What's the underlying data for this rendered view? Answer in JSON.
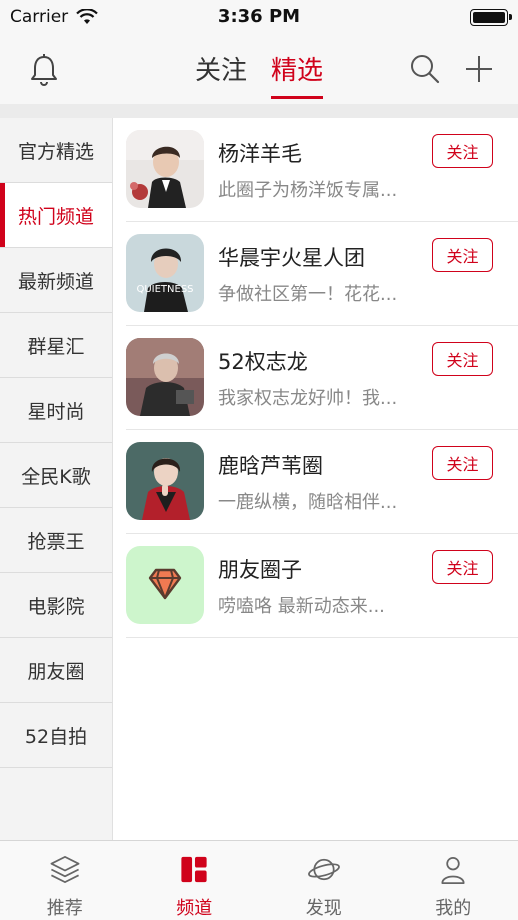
{
  "status_bar": {
    "carrier": "Carrier",
    "time": "3:36 PM"
  },
  "nav": {
    "tabs": [
      {
        "label": "关注"
      },
      {
        "label": "精选"
      }
    ],
    "active_tab": 1,
    "icons": {
      "left": "bell-icon",
      "search": "search-icon",
      "add": "plus-icon"
    }
  },
  "sidebar": {
    "items": [
      {
        "label": "官方精选"
      },
      {
        "label": "热门频道"
      },
      {
        "label": "最新频道"
      },
      {
        "label": "群星汇"
      },
      {
        "label": "星时尚"
      },
      {
        "label": "全民K歌"
      },
      {
        "label": "抢票王"
      },
      {
        "label": "电影院"
      },
      {
        "label": "朋友圈"
      },
      {
        "label": "52自拍"
      }
    ],
    "active_index": 1
  },
  "list": {
    "follow_label": "关注",
    "items": [
      {
        "title": "杨洋羊毛",
        "desc": "此圈子为杨洋饭专属..."
      },
      {
        "title": "华晨宇火星人团",
        "desc": "争做社区第一！花花...",
        "avatar_text": "QUIETNESS"
      },
      {
        "title": "52权志龙",
        "desc": "我家权志龙好帅！我..."
      },
      {
        "title": "鹿晗芦苇圈",
        "desc": "一鹿纵横，随晗相伴..."
      },
      {
        "title": "朋友圈子",
        "desc": "唠嗑咯 最新动态来..."
      }
    ]
  },
  "tab_bar": {
    "items": [
      {
        "label": "推荐",
        "icon": "layers-icon"
      },
      {
        "label": "频道",
        "icon": "channel-grid-icon"
      },
      {
        "label": "发现",
        "icon": "planet-icon"
      },
      {
        "label": "我的",
        "icon": "person-icon"
      }
    ],
    "active_index": 1
  },
  "colors": {
    "accent": "#d0021b",
    "text": "#333333",
    "muted": "#888888"
  }
}
